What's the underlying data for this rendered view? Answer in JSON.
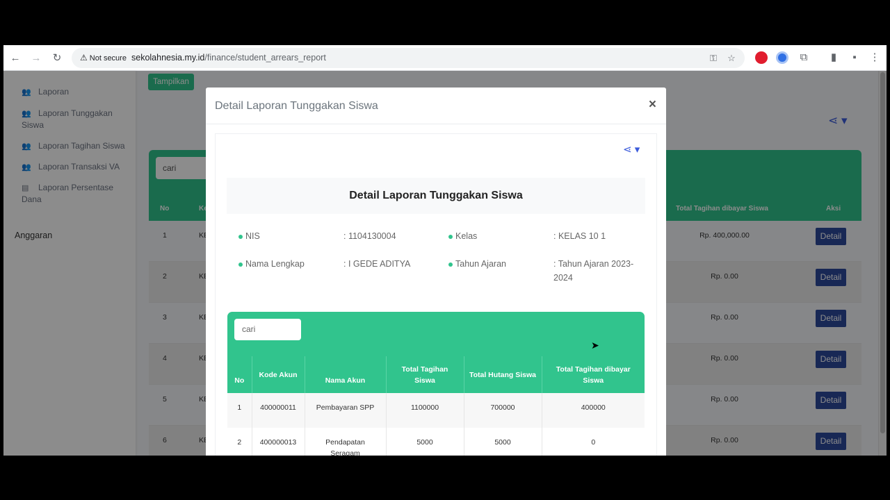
{
  "browser": {
    "security_label": "Not secure",
    "url_host": "sekolahnesia.my.id",
    "url_path": "/finance/student_arrears_report"
  },
  "sidebar": {
    "items": [
      {
        "label": "Laporan"
      },
      {
        "label": "Laporan Tunggakan Siswa"
      },
      {
        "label": "Laporan Tagihan Siswa"
      },
      {
        "label": "Laporan Transaksi VA"
      },
      {
        "label": "Laporan Persentase Dana"
      }
    ],
    "section": "Anggaran"
  },
  "background": {
    "show_button": "Tampilkan",
    "search_placeholder": "cari",
    "headers": {
      "no": "No",
      "ke": "Ke",
      "paid": "Total Tagihan dibayar Siswa",
      "action": "Aksi"
    },
    "rows": [
      {
        "no": "1",
        "ke": "KE",
        "paid": "Rp. 400,000.00",
        "action": "Detail"
      },
      {
        "no": "2",
        "ke": "KE",
        "paid": "Rp. 0.00",
        "action": "Detail"
      },
      {
        "no": "3",
        "ke": "KE",
        "paid": "Rp. 0.00",
        "action": "Detail"
      },
      {
        "no": "4",
        "ke": "KE",
        "paid": "Rp. 0.00",
        "action": "Detail"
      },
      {
        "no": "5",
        "ke": "KE",
        "paid": "Rp. 0.00",
        "action": "Detail"
      },
      {
        "no": "6",
        "ke": "KE",
        "paid": "Rp. 0.00",
        "action": "Detail"
      }
    ]
  },
  "modal": {
    "title": "Detail Laporan Tunggakan Siswa",
    "close": "×",
    "report_title": "Detail Laporan Tunggakan Siswa",
    "info": {
      "nis_label": "NIS",
      "nis_value": ": 1104130004",
      "kelas_label": "Kelas",
      "kelas_value": ": KELAS 10 1",
      "nama_label": "Nama Lengkap",
      "nama_value": ": I GEDE ADITYA",
      "tahun_label": "Tahun Ajaran",
      "tahun_value": ": Tahun Ajaran 2023-2024"
    },
    "search_placeholder": "cari",
    "table": {
      "headers": [
        "No",
        "Kode Akun",
        "Nama Akun",
        "Total Tagihan Siswa",
        "Total Hutang Siswa",
        "Total Tagihan dibayar Siswa"
      ],
      "rows": [
        [
          "1",
          "400000011",
          "Pembayaran SPP",
          "1100000",
          "700000",
          "400000"
        ],
        [
          "2",
          "400000013",
          "Pendapatan Seragam",
          "5000",
          "5000",
          "0"
        ]
      ]
    }
  }
}
